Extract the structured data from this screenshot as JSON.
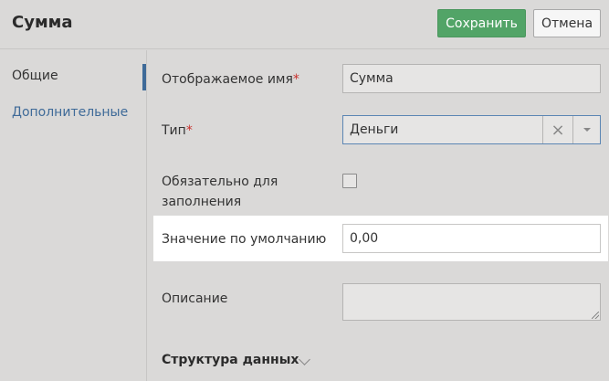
{
  "header": {
    "title": "Сумма",
    "save_label": "Сохранить",
    "cancel_label": "Отмена"
  },
  "sidebar": {
    "items": [
      {
        "label": "Общие",
        "active": true
      },
      {
        "label": "Дополнительные",
        "active": false
      }
    ]
  },
  "form": {
    "display_name": {
      "label": "Отображаемое имя",
      "required": "*",
      "value": "Сумма"
    },
    "type": {
      "label": "Тип",
      "required": "*",
      "value": "Деньги",
      "clear_glyph": "×"
    },
    "mandatory": {
      "label_line1": "Обязательно для",
      "label_line2": "заполнения",
      "checked": false
    },
    "default_value": {
      "label": "Значение по умолчанию",
      "value": "0,00"
    },
    "description": {
      "label": "Описание",
      "value": ""
    }
  },
  "section": {
    "title": "Структура данных"
  },
  "colors": {
    "accent": "#3e6a98",
    "save": "#52a467",
    "required": "#c9302c"
  }
}
